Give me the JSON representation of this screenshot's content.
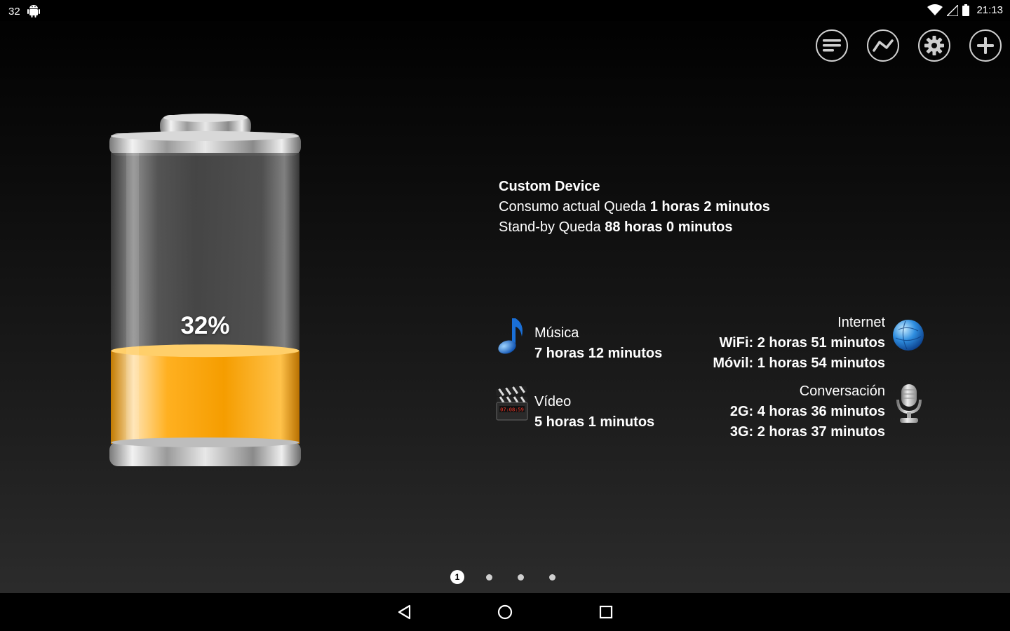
{
  "status_bar": {
    "notification_count": "32",
    "time": "21:13",
    "icons": [
      "android-icon",
      "wifi-icon",
      "signal-icon",
      "battery-icon"
    ]
  },
  "toolbar": {
    "buttons": [
      "list-icon",
      "graph-icon",
      "settings-gear-icon",
      "add-icon"
    ]
  },
  "battery": {
    "percent_label": "32%",
    "level": 0.32,
    "fill_color": "#f5a300"
  },
  "device": {
    "name": "Custom Device",
    "current_label": "Consumo actual Queda",
    "current_value": "1 horas 2 minutos",
    "standby_label": "Stand-by Queda",
    "standby_value": "88 horas 0 minutos"
  },
  "usage": {
    "music": {
      "label": "Música",
      "value": "7 horas 12 minutos",
      "icon": "music-note-icon"
    },
    "video": {
      "label": "Vídeo",
      "value": "5 horas 1 minutos",
      "icon": "clapperboard-icon",
      "clock_text": "07:08:59"
    },
    "internet": {
      "label": "Internet",
      "wifi": "WiFi: 2 horas 51 minutos",
      "mobile": "Móvil: 1 horas 54 minutos",
      "icon": "globe-icon"
    },
    "talk": {
      "label": "Conversación",
      "2g": "2G: 4 horas 36 minutos",
      "3g": "3G: 2 horas 37 minutos",
      "icon": "microphone-icon"
    }
  },
  "pager": {
    "current": "1",
    "total": 4
  },
  "nav": {
    "buttons": [
      "back-icon",
      "home-icon",
      "recents-icon"
    ]
  }
}
